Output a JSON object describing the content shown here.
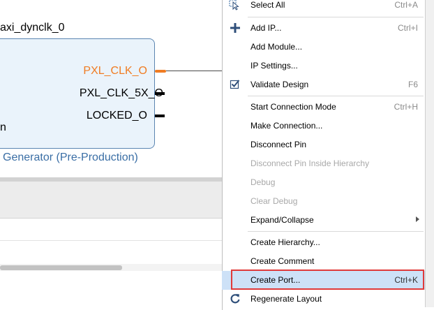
{
  "canvas": {
    "block_name": "axi_dynclk_0",
    "ports": {
      "pxl_clk": "PXL_CLK_O",
      "pxl_clk_5x": "PXL_CLK_5X_O",
      "locked": "LOCKED_O"
    },
    "partial_port_letter": "n",
    "block_title": "Generator (Pre-Production)"
  },
  "context_menu": {
    "select_all": {
      "label": "Select All",
      "shortcut": "Ctrl+A",
      "icon": "select-all-cursor-icon"
    },
    "add_ip": {
      "label": "Add IP...",
      "shortcut": "Ctrl+I",
      "icon": "plus-icon"
    },
    "add_module": {
      "label": "Add Module..."
    },
    "ip_settings": {
      "label": "IP Settings..."
    },
    "validate_design": {
      "label": "Validate Design",
      "shortcut": "F6",
      "icon": "checkbox-check-icon"
    },
    "start_connection_mode": {
      "label": "Start Connection Mode",
      "shortcut": "Ctrl+H"
    },
    "make_connection": {
      "label": "Make Connection..."
    },
    "disconnect_pin": {
      "label": "Disconnect Pin"
    },
    "disconnect_pin_hierarchy": {
      "label": "Disconnect Pin Inside Hierarchy"
    },
    "debug": {
      "label": "Debug"
    },
    "clear_debug": {
      "label": "Clear Debug"
    },
    "expand_collapse": {
      "label": "Expand/Collapse"
    },
    "create_hierarchy": {
      "label": "Create Hierarchy..."
    },
    "create_comment": {
      "label": "Create Comment"
    },
    "create_port": {
      "label": "Create Port...",
      "shortcut": "Ctrl+K"
    },
    "regenerate_layout": {
      "label": "Regenerate Layout",
      "icon": "refresh-icon"
    }
  },
  "colors": {
    "clock_port": "#f07c22",
    "block_fill": "#eaf3fb",
    "block_border": "#5b85b1",
    "block_title": "#3a6ea5",
    "menu_hover": "#cde1f7",
    "callout_red": "#e03a3a"
  }
}
